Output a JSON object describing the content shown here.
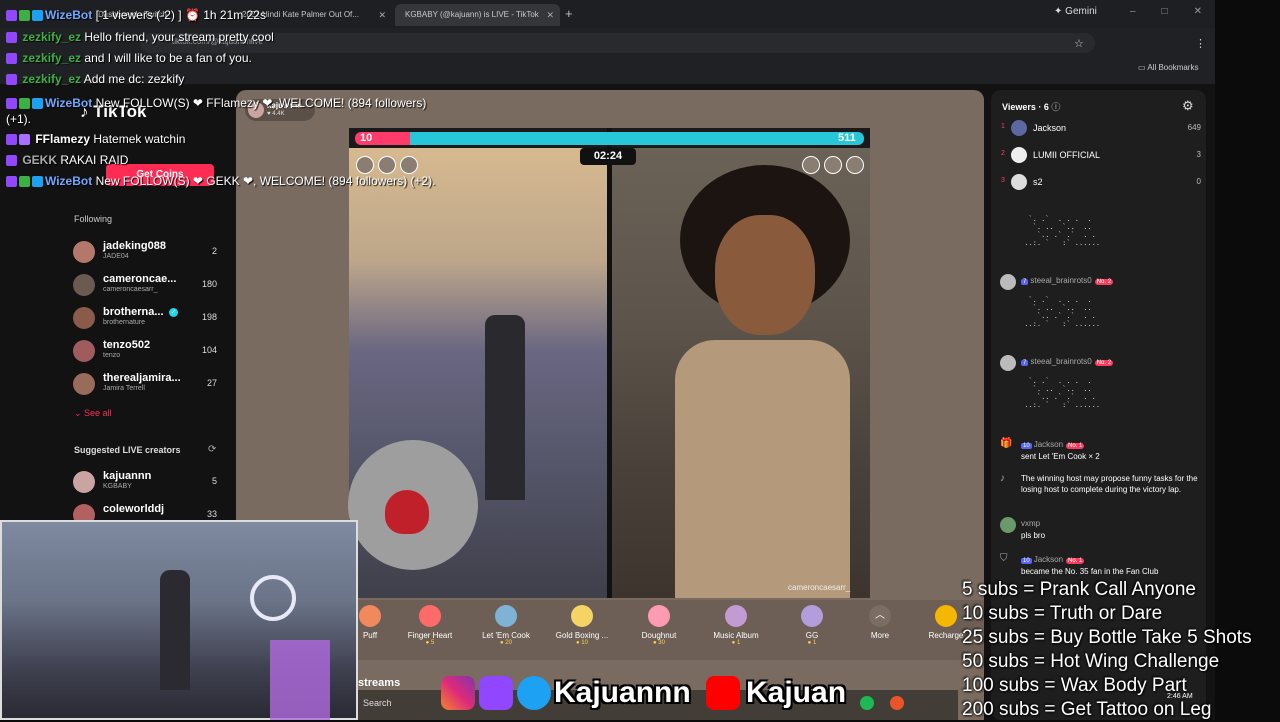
{
  "browser": {
    "tabs": [
      {
        "title": "Dashboard - Twitch"
      },
      {
        "title": "2021 Hindi Kate Palmer Out Of..."
      },
      {
        "title": "KGBABY (@kajuann) is LIVE - TikTok"
      }
    ],
    "url": "tiktok.com/@kajuannnlive",
    "gemini_label": "Gemini",
    "bookmarks_label": "All Bookmarks"
  },
  "stream_overlay": {
    "viewer_counter": "[ 1 viewers (-2) ]",
    "uptime": "1h 21m 22s",
    "chat": [
      {
        "name": "WizeBot",
        "text": "",
        "color": "#6fa8ff"
      },
      {
        "name": "zezkify_ez",
        "text": "Hello friend, your stream pretty cool",
        "color": "#3cb043"
      },
      {
        "name": "zezkify_ez",
        "text": "and I will like to be a fan of you.",
        "color": "#3cb043"
      },
      {
        "name": "zezkify_ez",
        "text": "Add me dc: zezkify",
        "color": "#3cb043"
      },
      {
        "name": "WizeBot",
        "text": "New FOLLOW(S) ❤ FFlamezy ❤, WELCOME! (894 followers)",
        "color": "#6fa8ff"
      },
      {
        "name": "",
        "text": "(+1).",
        "color": "#ffffff"
      },
      {
        "name": "FFlamezy",
        "text": "Hatemek watchin",
        "color": "#ffffff"
      },
      {
        "name": "GEKK",
        "text": "RAKAI RAID",
        "color": "#aaaaaa"
      },
      {
        "name": "WizeBot",
        "text": "New FOLLOW(S) ❤ GEKK ❤, WELCOME! (894 followers) (+2).",
        "color": "#6fa8ff"
      }
    ],
    "subs_goals": [
      "5 subs = Prank Call Anyone",
      "10 subs = Truth or Dare",
      "25 subs = Buy Bottle Take 5 Shots",
      "50 subs = Hot Wing Challenge",
      "100 subs = Wax Body Part",
      "200 subs = Get Tattoo on Leg"
    ],
    "social_name_1": "Kajuannn",
    "social_name_2": "Kajuan"
  },
  "tiktok": {
    "logo": "TikTok",
    "get_coins": "Get Coins",
    "host_name": "kajuannn",
    "host_likes": "4.4K",
    "following_label": "Following",
    "following": [
      {
        "name": "jadeking088",
        "sub": "JADE04",
        "count": "2"
      },
      {
        "name": "cameroncae...",
        "sub": "cameroncaesarr_",
        "count": "180"
      },
      {
        "name": "brotherna...",
        "sub": "brothernature",
        "count": "198"
      },
      {
        "name": "tenzo502",
        "sub": "tenzo",
        "count": "104"
      },
      {
        "name": "therealjamira...",
        "sub": "Jamira Terrell",
        "count": "27"
      }
    ],
    "see_all": "See all",
    "suggested_label": "Suggested LIVE creators",
    "suggested": [
      {
        "name": "kajuannn",
        "sub": "KGBABY",
        "count": "5"
      },
      {
        "name": "coleworlddj",
        "sub": "",
        "count": "33"
      }
    ],
    "pk": {
      "left_score": "10",
      "right_score": "511",
      "timer": "02:24"
    },
    "stream_watermark": "cameroncaesarr_",
    "gifts": [
      {
        "name": "Puff",
        "cost": "",
        "color": "#f08a5d"
      },
      {
        "name": "Finger Heart",
        "cost": "5",
        "color": "#ff6b6b"
      },
      {
        "name": "Let 'Em Cook",
        "cost": "20",
        "color": "#7fb3d5"
      },
      {
        "name": "Gold Boxing ...",
        "cost": "10",
        "color": "#f6d365"
      },
      {
        "name": "Doughnut",
        "cost": "30",
        "color": "#ff9ab3"
      },
      {
        "name": "Music Album",
        "cost": "1",
        "color": "#c39bd3"
      },
      {
        "name": "GG",
        "cost": "1",
        "color": "#b39ddb"
      }
    ],
    "more_label": "More",
    "recharge_label": "Recharge",
    "streams_label": "streams",
    "viewers_label": "Viewers",
    "viewers_count": "6",
    "viewers": [
      {
        "rank": "1",
        "name": "Jackson",
        "count": "649"
      },
      {
        "rank": "2",
        "name": "LUMII OFFICIAL",
        "count": "3"
      },
      {
        "rank": "3",
        "name": "s2",
        "count": "0"
      }
    ],
    "chat": [
      {
        "name": "steeal_brainrots0",
        "level": "7",
        "badge": "No. 2",
        "text": ""
      },
      {
        "name": "steeal_brainrots0",
        "level": "7",
        "badge": "No. 2",
        "text": ""
      },
      {
        "name": "Jackson",
        "level": "10",
        "badge": "No. 1",
        "text": "sent Let 'Em Cook × 2"
      },
      {
        "name": "",
        "level": "",
        "badge": "",
        "text": "The winning host may propose funny tasks for the losing host to complete during the victory lap."
      },
      {
        "name": "vxmp",
        "level": "",
        "badge": "",
        "text": "pls bro"
      },
      {
        "name": "Jackson",
        "level": "10",
        "badge": "No. 1",
        "text": "became the No. 35 fan in the Fan Club"
      }
    ]
  },
  "taskbar": {
    "search": "Search",
    "time": "2:46 AM"
  }
}
